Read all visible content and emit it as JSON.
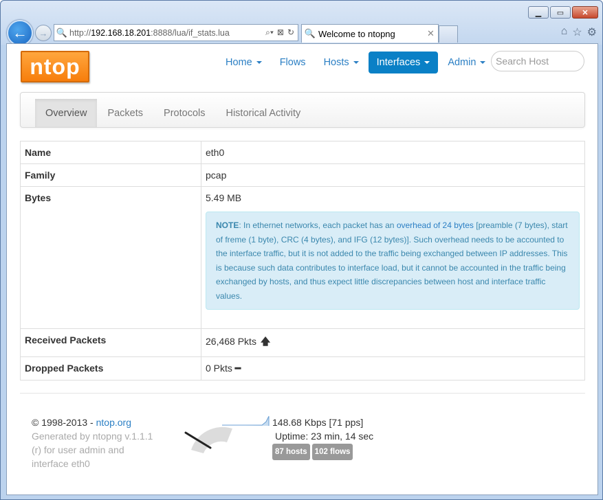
{
  "browser": {
    "url_prefix": "http://",
    "url_host": "192.168.18.201",
    "url_rest": ":8888/lua/if_stats.lua",
    "tab_title": "Welcome to ntopng"
  },
  "navbar": {
    "logo_text": "ntop",
    "items": [
      {
        "label": "Home",
        "dropdown": true,
        "active": false
      },
      {
        "label": "Flows",
        "dropdown": false,
        "active": false
      },
      {
        "label": "Hosts",
        "dropdown": true,
        "active": false
      },
      {
        "label": "Interfaces",
        "dropdown": true,
        "active": true
      },
      {
        "label": "Admin",
        "dropdown": true,
        "active": false
      }
    ],
    "search_placeholder": "Search Host"
  },
  "subnav": {
    "tabs": [
      {
        "label": "Overview",
        "active": true
      },
      {
        "label": "Packets",
        "active": false
      },
      {
        "label": "Protocols",
        "active": false
      },
      {
        "label": "Historical Activity",
        "active": false
      }
    ]
  },
  "stats": {
    "name_label": "Name",
    "name_value": "eth0",
    "family_label": "Family",
    "family_value": "pcap",
    "bytes_label": "Bytes",
    "bytes_value": "5.49 MB",
    "note_prefix": "NOTE",
    "note_text_1": ": In ethernet networks, each packet has an ",
    "note_highlight": "overhead of 24 bytes",
    "note_text_2": " [preamble (7 bytes), start of freme (1 byte), CRC (4 bytes), and IFG (12 bytes)]. Such overhead needs to be accounted to the interface traffic, but it is not added to the traffic being exchanged between IP addresses. This is because such data contributes to interface load, but it cannot be accounted in the traffic being exchanged by hosts, and thus expect little discrepancies between host and interface traffic values.",
    "received_label": "Received Packets",
    "received_value": "26,468 Pkts",
    "dropped_label": "Dropped Packets",
    "dropped_value": "0 Pkts"
  },
  "footer": {
    "copyright": "© 1998-2013 - ",
    "copyright_link": "ntop.org",
    "generated": "Generated by ntopng v.1.1.1 (r) for user admin and interface eth0",
    "throughput": "148.68 Kbps [71 pps]",
    "uptime": "Uptime: 23 min, 14 sec",
    "hosts_badge": "87 hosts",
    "flows_badge": "102 flows"
  }
}
